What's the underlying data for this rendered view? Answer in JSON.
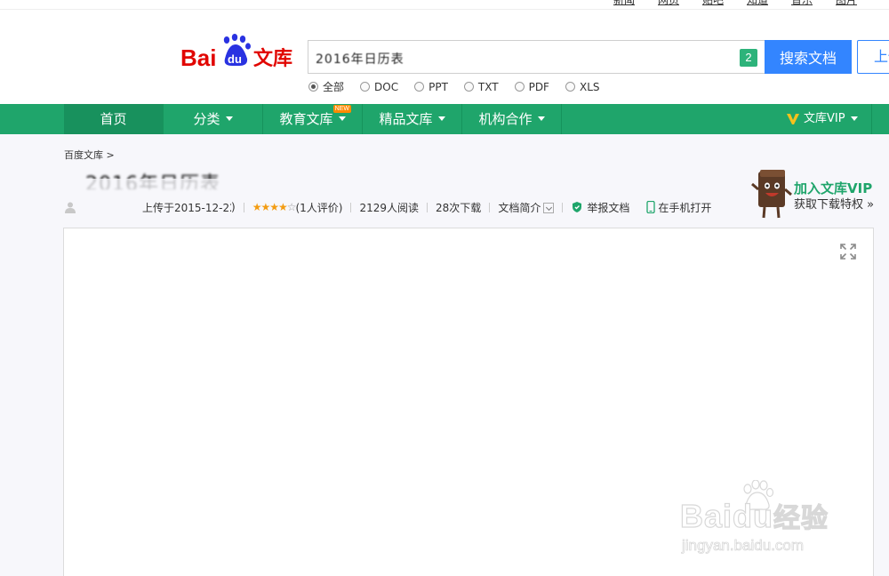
{
  "top_links": [
    "新闻",
    "网页",
    "贴吧",
    "知道",
    "音乐",
    "图片"
  ],
  "logo": {
    "text_bai": "Bai",
    "text_du": "du",
    "text_wenku": "文库"
  },
  "search": {
    "value": "2016年日历表",
    "badge": "2",
    "button_label": "搜索文档",
    "upload_label": "上传"
  },
  "filetypes": [
    {
      "label": "全部",
      "selected": true
    },
    {
      "label": "DOC",
      "selected": false
    },
    {
      "label": "PPT",
      "selected": false
    },
    {
      "label": "TXT",
      "selected": false
    },
    {
      "label": "PDF",
      "selected": false
    },
    {
      "label": "XLS",
      "selected": false
    }
  ],
  "nav": {
    "items": [
      {
        "label": "首页",
        "active": true,
        "dropdown": false
      },
      {
        "label": "分类",
        "dropdown": true
      },
      {
        "label": "教育文库",
        "dropdown": true,
        "tag": "NEW"
      },
      {
        "label": "精品文库",
        "dropdown": true
      },
      {
        "label": "机构合作",
        "dropdown": true
      }
    ],
    "vip_label": "文库VIP"
  },
  "breadcrumb": "百度文库 >",
  "doc": {
    "title": "2016年日历表",
    "uploader": "上传于2015-12-22",
    "rating_stars": "★★★★",
    "rating_empty": "☆",
    "rating_text": "(1人评价)",
    "reads": "2129人阅读",
    "downloads": "28次下载",
    "intro": "文档简介",
    "report": "举报文档",
    "mobile": "在手机打开"
  },
  "vip_promo": {
    "title": "加入文库VIP",
    "subtitle": "获取下载特权 »"
  },
  "watermark": {
    "brand": "Bai",
    "brand2": "du",
    "brand3": "经验",
    "url": "jingyan.baidu.com"
  },
  "colors": {
    "nav_green": "#1fa56b",
    "search_blue": "#3385ff",
    "vip_gold": "#f6c21c"
  }
}
